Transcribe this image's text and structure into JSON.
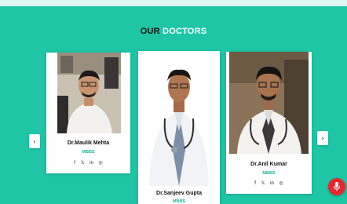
{
  "section": {
    "title_part1": "OUR",
    "title_part2": "DOCTORS"
  },
  "doctors": [
    {
      "name": "Dr.Maulik Mehta",
      "degree": "MBBS",
      "social": [
        "f",
        "𝕏",
        "in",
        "◎"
      ]
    },
    {
      "name": "Dr.Sanjeev Gupta",
      "degree": "MBBS"
    },
    {
      "name": "Dr.Anil Kumar",
      "degree": "MBBS",
      "social": [
        "f",
        "𝕏",
        "in",
        "◎"
      ]
    }
  ],
  "icons": {
    "prev": "chevron-left-icon",
    "next": "chevron-right-icon",
    "mic": "microphone-icon",
    "prev_glyph": "‹",
    "next_glyph": "›"
  },
  "colors": {
    "background": "#1ec6a6",
    "accent": "#18b595",
    "mic": "#e6262e"
  }
}
